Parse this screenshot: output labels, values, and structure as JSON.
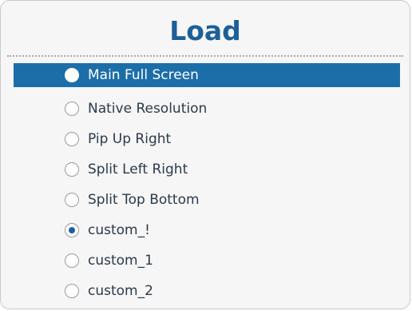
{
  "panel": {
    "title": "Load"
  },
  "accent_color": "#1c6ea8",
  "title_color": "#1d5f99",
  "items": [
    {
      "label": "Main Full Screen",
      "highlighted": true,
      "checked": false,
      "icon": "radio-icon"
    },
    {
      "label": "Native Resolution",
      "highlighted": false,
      "checked": false,
      "icon": "radio-icon"
    },
    {
      "label": "Pip Up Right",
      "highlighted": false,
      "checked": false,
      "icon": "radio-icon"
    },
    {
      "label": "Split Left Right",
      "highlighted": false,
      "checked": false,
      "icon": "radio-icon"
    },
    {
      "label": "Split Top Bottom",
      "highlighted": false,
      "checked": false,
      "icon": "radio-icon"
    },
    {
      "label": "custom_!",
      "highlighted": false,
      "checked": true,
      "icon": "radio-icon"
    },
    {
      "label": "custom_1",
      "highlighted": false,
      "checked": false,
      "icon": "radio-icon"
    },
    {
      "label": "custom_2",
      "highlighted": false,
      "checked": false,
      "icon": "radio-icon"
    }
  ]
}
